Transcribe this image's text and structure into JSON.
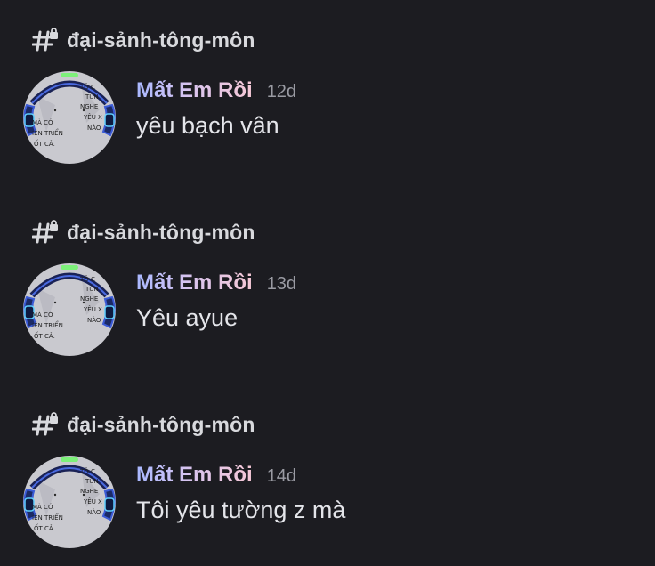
{
  "results": [
    {
      "channel": "đại-sảnh-tông-môn",
      "author": "Mất Em Rồi",
      "timestamp": "12d",
      "message": "yêu bạch vân"
    },
    {
      "channel": "đại-sảnh-tông-môn",
      "author": "Mất Em Rồi",
      "timestamp": "13d",
      "message": "Yêu ayue"
    },
    {
      "channel": "đại-sảnh-tông-môn",
      "author": "Mất Em Rồi",
      "timestamp": "14d",
      "message": "Tôi yêu tường z mà"
    }
  ],
  "avatar_text": {
    "line1": "TÔ C",
    "line2": "TÙN",
    "line3": "NGHE",
    "line4": "YÊU X",
    "line5": "NÀO",
    "line6": "MÀ CÓ",
    "line7": "IÊN TRIỂN",
    "line8": "ỐT CẢ."
  },
  "colors": {
    "background": "#1c1c21",
    "channel_text": "#d8d9dd",
    "author_gradient_start": "#a9b8ff",
    "author_gradient_end": "#f6c8d6",
    "timestamp": "#9a9ba3",
    "message_text": "#e4e5ea"
  },
  "icons": {
    "channel": "locked-text-channel-icon",
    "avatar": "user-avatar"
  }
}
